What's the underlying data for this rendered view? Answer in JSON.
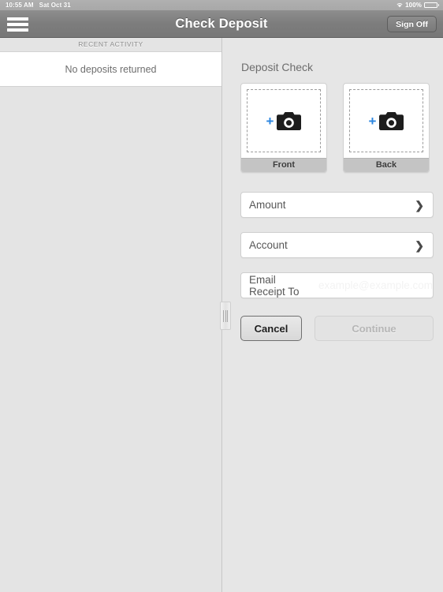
{
  "status_bar": {
    "time": "10:55 AM",
    "date": "Sat Oct 31",
    "battery_percent": "100%",
    "wifi_icon": "wifi-icon",
    "battery_icon": "battery-icon"
  },
  "navbar": {
    "menu_icon": "hamburger-menu-icon",
    "title": "Check Deposit",
    "sign_off_label": "Sign Off"
  },
  "left_pane": {
    "section_header": "RECENT ACTIVITY",
    "empty_message": "No deposits returned"
  },
  "right_pane": {
    "title": "Deposit Check",
    "captures": [
      {
        "label": "Front",
        "plus": "+",
        "icon": "camera-icon"
      },
      {
        "label": "Back",
        "plus": "+",
        "icon": "camera-icon"
      }
    ],
    "fields": [
      {
        "label": "Amount",
        "chevron": "❯"
      },
      {
        "label": "Account",
        "chevron": "❯"
      }
    ],
    "email_field": {
      "label": "Email Receipt To",
      "placeholder": "example@example.com",
      "value": ""
    },
    "buttons": {
      "cancel_label": "Cancel",
      "continue_label": "Continue"
    }
  },
  "colors": {
    "accent_blue": "#2b86e0",
    "navbar_gray": "#7d7d7d",
    "background_gray": "#e6e6e6",
    "capture_label_gray": "#c4c4c4"
  }
}
